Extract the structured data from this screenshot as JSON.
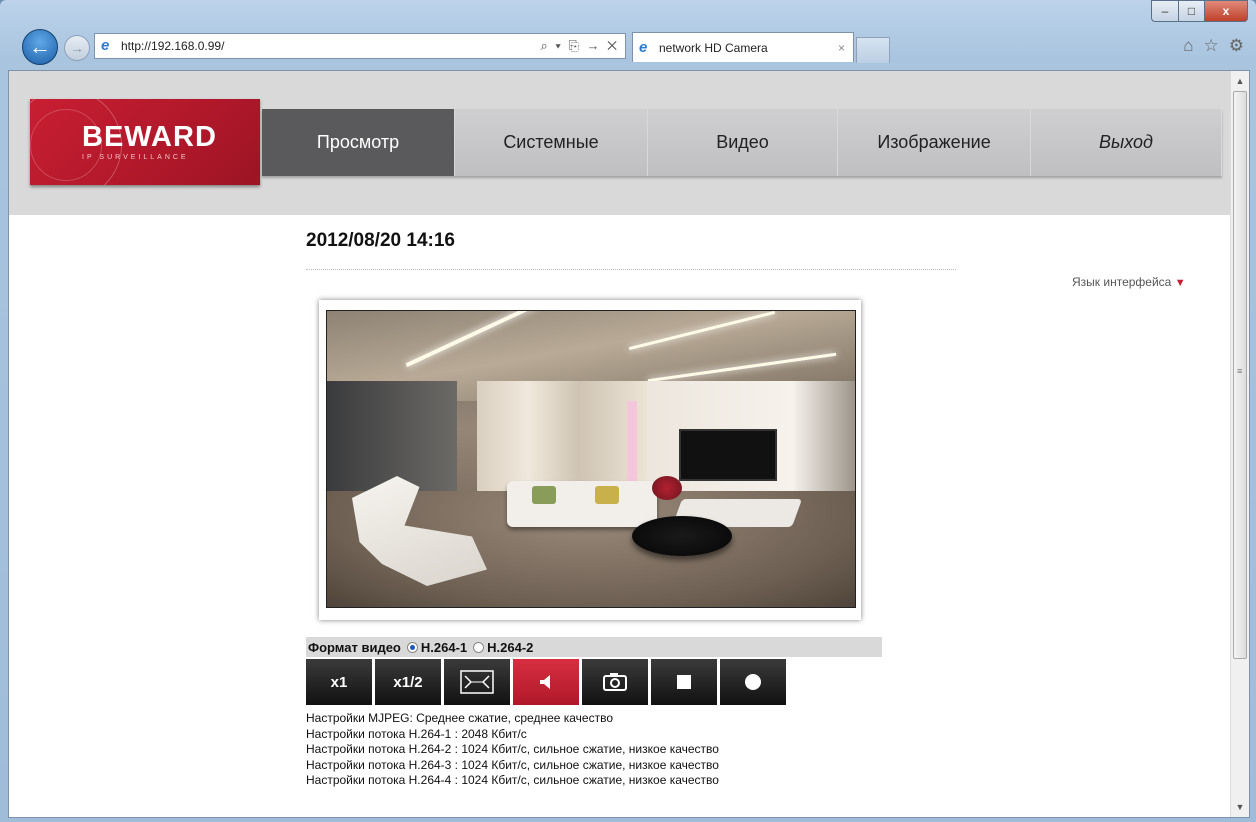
{
  "browser": {
    "window_controls": {
      "minimize": "–",
      "maximize": "□",
      "close": "x"
    },
    "back_glyph": "←",
    "forward_glyph": "→",
    "address": "http://192.168.0.99/",
    "address_tools": "⌕ ▾ ⎘ → ✕",
    "tab_title": "network HD Camera",
    "tab_close": "×",
    "right_tools": [
      "⌂",
      "☆",
      "⚙"
    ]
  },
  "header": {
    "logo_name": "BEWARD",
    "logo_sub": "IP SURVEILLANCE",
    "menu": [
      "Просмотр",
      "Системные",
      "Видео",
      "Изображение",
      "Выход"
    ],
    "active_menu": "Просмотр"
  },
  "main": {
    "datetime": "2012/08/20 14:16",
    "language_label": "Язык интерфейса",
    "language_arrow": "▼",
    "format_label": "Формат видео",
    "format_options": [
      "H.264-1",
      "H.264-2"
    ],
    "format_selected": "H.264-1",
    "controls": {
      "x1": "x1",
      "x1_2": "x1/2",
      "fullscreen_icon": "fit-screen-icon",
      "sound_icon": "speaker-icon",
      "snapshot_icon": "camera-icon",
      "stop_icon": "stop-icon",
      "record_icon": "record-icon"
    },
    "info_lines": [
      "Настройки MJPEG: Среднее сжатие, среднее качество",
      "Настройки потока H.264-1 : 2048 Кбит/с",
      "Настройки потока H.264-2 : 1024 Кбит/с, сильное сжатие, низкое качество",
      "Настройки потока H.264-3 : 1024 Кбит/с, сильное сжатие, низкое качество",
      "Настройки потока H.264-4 : 1024 Кбит/с, сильное сжатие, низкое качество"
    ]
  },
  "colors": {
    "brand_red": "#c81e32",
    "menu_active": "#5a5a5c",
    "menu_bg": "#c7c7c9",
    "band_bg": "#d9d9da"
  }
}
